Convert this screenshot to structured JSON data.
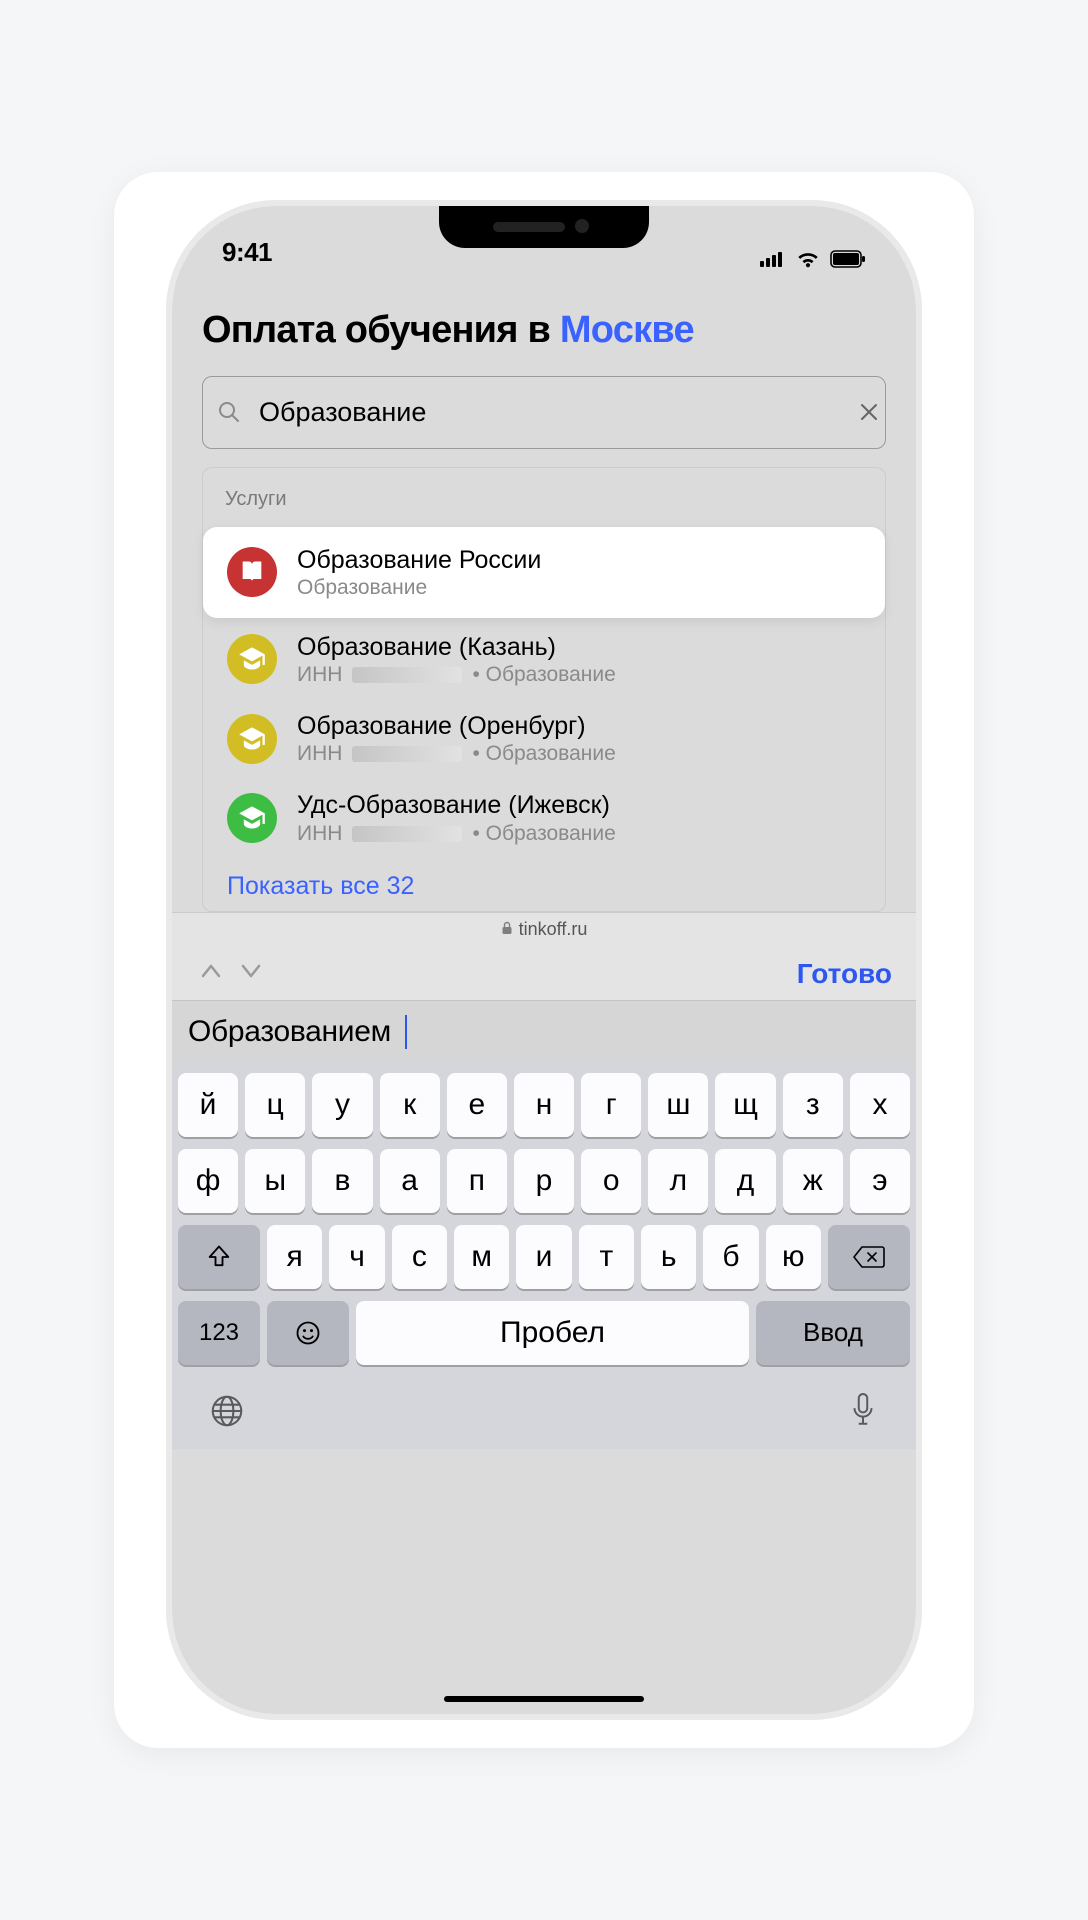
{
  "status": {
    "time": "9:41"
  },
  "header": {
    "title_prefix": "Оплата обучения в ",
    "city": "Москве"
  },
  "search": {
    "value": "Образование"
  },
  "panel": {
    "heading": "Услуги",
    "items": [
      {
        "title": "Образование России",
        "sub_plain": "Образование",
        "icon": "book",
        "color": "red",
        "masked": false,
        "highlighted": true
      },
      {
        "title": "Образование (Казань)",
        "sub_prefix": "ИНН ",
        "sub_suffix": " • Образование",
        "icon": "cap",
        "color": "yellow",
        "masked": true,
        "highlighted": false
      },
      {
        "title": "Образование (Оренбург)",
        "sub_prefix": "ИНН ",
        "sub_suffix": " • Образование",
        "icon": "cap",
        "color": "yellow",
        "masked": true,
        "highlighted": false
      },
      {
        "title": "Удс-Образование (Ижевск)",
        "sub_prefix": "ИНН ",
        "sub_suffix": " • Образование",
        "icon": "cap",
        "color": "green",
        "masked": true,
        "highlighted": false
      }
    ],
    "show_all": "Показать все 32"
  },
  "address_bar": {
    "host": "tinkoff.ru"
  },
  "nav": {
    "done": "Готово"
  },
  "predictive": {
    "word": "Образованием"
  },
  "keyboard": {
    "row1": [
      "й",
      "ц",
      "у",
      "к",
      "е",
      "н",
      "г",
      "ш",
      "щ",
      "з",
      "х"
    ],
    "row2": [
      "ф",
      "ы",
      "в",
      "а",
      "п",
      "р",
      "о",
      "л",
      "д",
      "ж",
      "э"
    ],
    "row3": [
      "я",
      "ч",
      "с",
      "м",
      "и",
      "т",
      "ь",
      "б",
      "ю"
    ],
    "numbers": "123",
    "space": "Пробел",
    "enter": "Ввод"
  }
}
